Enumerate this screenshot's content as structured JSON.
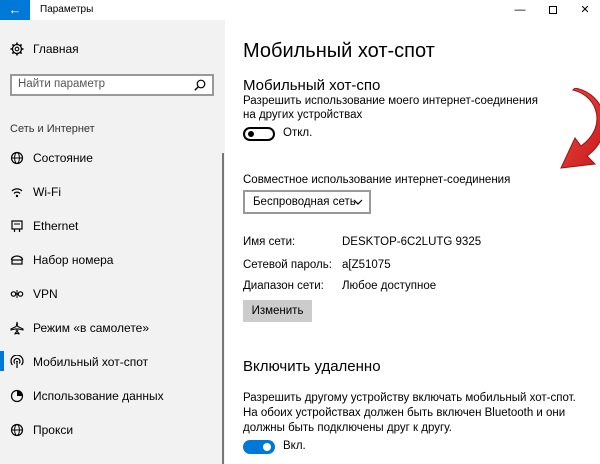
{
  "window": {
    "back_glyph": "←",
    "title": "Параметры",
    "minimize_glyph": "—",
    "close_glyph": "✕"
  },
  "sidebar": {
    "home_label": "Главная",
    "search_placeholder": "Найти параметр",
    "section_title": "Сеть и Интернет",
    "items": [
      {
        "label": "Состояние",
        "icon": "globe-icon",
        "active": false
      },
      {
        "label": "Wi-Fi",
        "icon": "wifi-icon",
        "active": false
      },
      {
        "label": "Ethernet",
        "icon": "ethernet-icon",
        "active": false
      },
      {
        "label": "Набор номера",
        "icon": "dialup-icon",
        "active": false
      },
      {
        "label": "VPN",
        "icon": "vpn-icon",
        "active": false
      },
      {
        "label": "Режим «в самолете»",
        "icon": "airplane-icon",
        "active": false
      },
      {
        "label": "Мобильный хот-спот",
        "icon": "hotspot-icon",
        "active": true
      },
      {
        "label": "Использование данных",
        "icon": "data-usage-icon",
        "active": false
      },
      {
        "label": "Прокси",
        "icon": "globe-icon",
        "active": false
      }
    ]
  },
  "main": {
    "page_title": "Мобильный хот-спот",
    "hotspot_title": "Мобильный хот-спо",
    "hotspot_desc": "Разрешить использование моего интернет-соединения на других устройствах",
    "hotspot_toggle_state": "off",
    "hotspot_toggle_label": "Откл.",
    "share_label": "Совместное использование интернет-соединения",
    "share_select_value": "Беспроводная сеть",
    "network_name_label": "Имя сети:",
    "network_name_value": "DESKTOP-6C2LUTG 9325",
    "password_label": "Сетевой пароль:",
    "password_value": "a[Z51075",
    "range_label": "Диапазон сети:",
    "range_value": "Любое доступное",
    "change_button": "Изменить",
    "remote_title": "Включить удаленно",
    "remote_desc": "Разрешить другому устройству включать мобильный хот-спот. На обоих устройствах должен быть включен Bluetooth и они должны быть подключены друг к другу.",
    "remote_toggle_state": "on",
    "remote_toggle_label": "Вкл."
  },
  "colors": {
    "accent": "#0078d7",
    "sidebar_bg": "#f2f2f2",
    "arrow": "#e3262a"
  }
}
